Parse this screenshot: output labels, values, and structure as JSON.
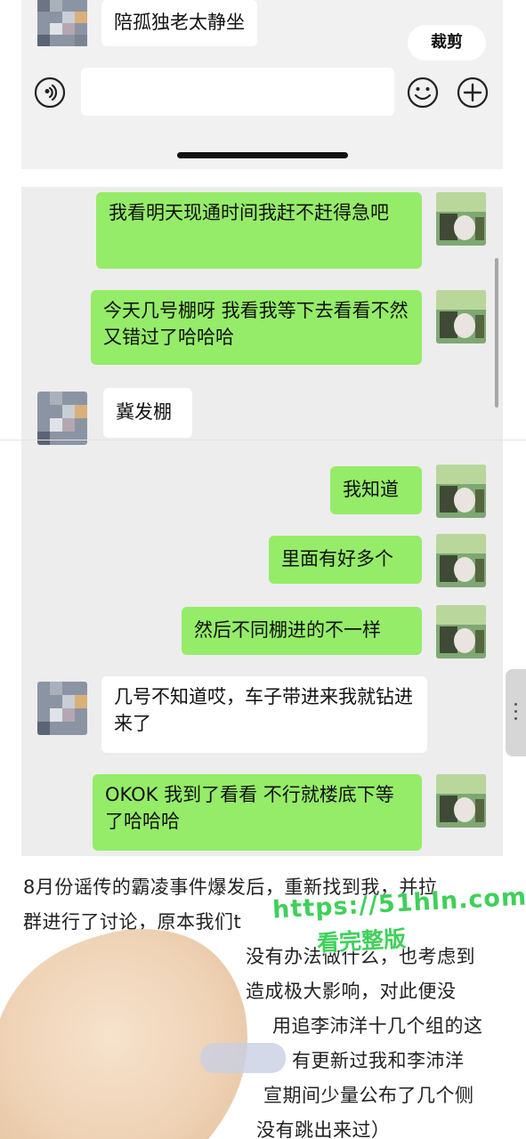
{
  "top_chat": {
    "contact_message": "陪孤独老太静坐",
    "crop_label": "裁剪",
    "input_value": ""
  },
  "chat": {
    "messages": [
      {
        "side": "right",
        "text": "我看明天现通时间我赶不赶得急吧"
      },
      {
        "side": "right",
        "text": "今天几号棚呀 我看我等下去看看不然又错过了哈哈哈"
      },
      {
        "side": "left",
        "text": "冀发棚"
      },
      {
        "side": "right",
        "text": "我知道"
      },
      {
        "side": "right",
        "text": "里面有好多个"
      },
      {
        "side": "right",
        "text": "然后不同棚进的不一样"
      },
      {
        "side": "left",
        "text": "几号不知道哎，车子带进来我就钻进来了"
      },
      {
        "side": "right",
        "text": "OKOK 我到了看看 不行就楼底下等了哈哈哈"
      }
    ]
  },
  "article": {
    "lines": [
      "8月份谣传的霸凌事件爆发后，重新找到我，并拉",
      "群进行了讨论，原本我们t",
      "没有办法做什么，也考虑到",
      "造成极大影响，对此便没",
      "用追李沛洋十几个组的这",
      "有更新过我和李沛洋",
      "宣期间少量公布了几个侧",
      "没有跳出来过）"
    ]
  },
  "watermark": {
    "url": "https://51hln.com",
    "subtitle": "看完整版"
  },
  "colors": {
    "sent_bubble": "#95ec69",
    "received_bubble": "#ffffff",
    "chat_bg": "#ededed",
    "watermark": "#3fd05a"
  }
}
